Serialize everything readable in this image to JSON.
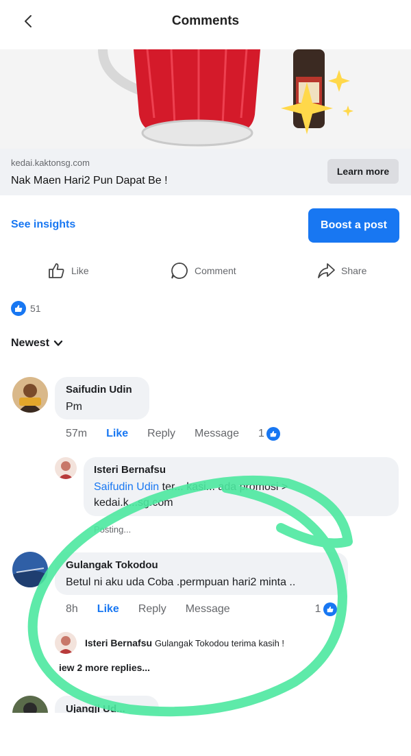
{
  "header": {
    "title": "Comments",
    "back_icon": "chevron-left-icon"
  },
  "link_preview": {
    "domain": "kedai.kaktonsg.com",
    "title": "Nak Maen Hari2 Pun Dapat Be !",
    "cta": "Learn more"
  },
  "post_tools": {
    "insights": "See insights",
    "boost": "Boost a post"
  },
  "actions": {
    "like": "Like",
    "comment": "Comment",
    "share": "Share"
  },
  "reactions": {
    "count": "51"
  },
  "sort": {
    "label": "Newest"
  },
  "comments": [
    {
      "name": "Saifudin Udin",
      "text": "Pm",
      "time": "57m",
      "like": "Like",
      "reply": "Reply",
      "message": "Message",
      "likes": "1"
    },
    {
      "name": "Gulangak Tokodou",
      "text": "Betul ni aku uda Coba .permpuan hari2 minta ..",
      "time": "8h",
      "like": "Like",
      "reply": "Reply",
      "message": "Message",
      "likes": "1"
    },
    {
      "name": "Ujangji Ud..."
    }
  ],
  "replies": [
    {
      "name": "Isteri Bernafsu",
      "mention": "Saifudin Udin",
      "text": "ter... kasi... ada promosi >",
      "text2": "kedai.k...sg.com",
      "status": "Posting..."
    },
    {
      "name": "Isteri Bernafsu",
      "text": "Gulangak Tokodou terima kasih !"
    }
  ],
  "view_more": "iew 2 more replies...",
  "colors": {
    "accent": "#1877f2",
    "annotation": "#4de8a0",
    "bubble": "#f0f2f5"
  }
}
